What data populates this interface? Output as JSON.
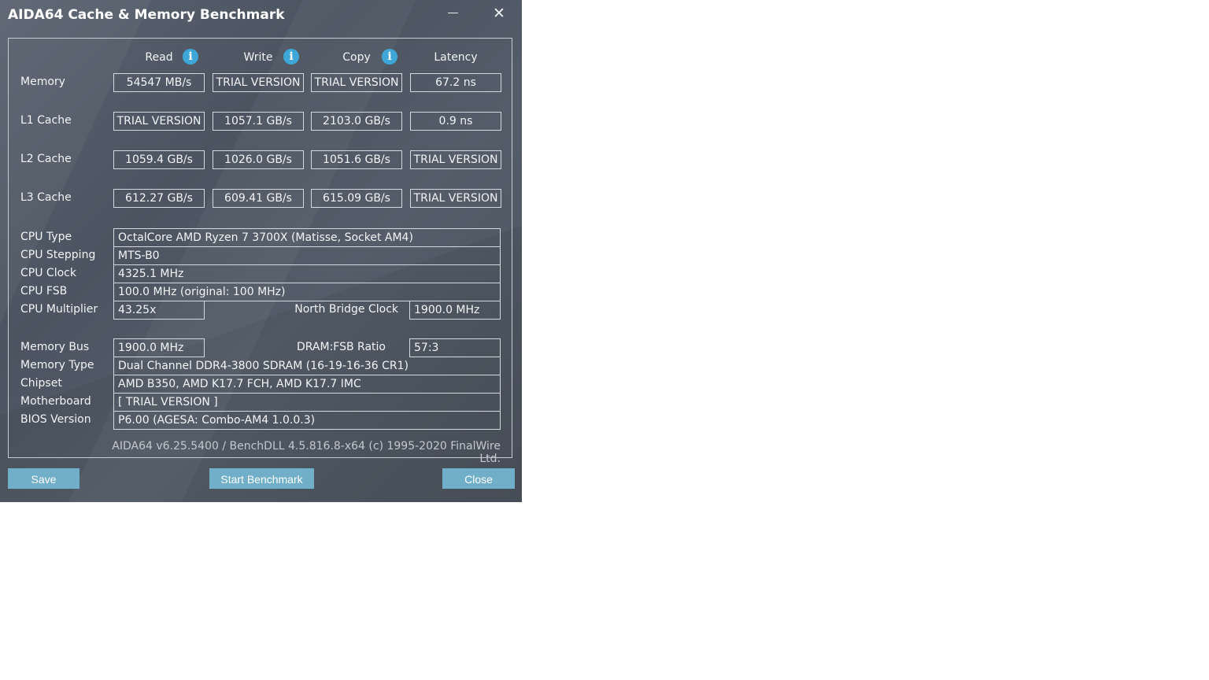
{
  "window": {
    "title": "AIDA64 Cache & Memory Benchmark",
    "close_glyph": "✕"
  },
  "columns": [
    "Read",
    "Write",
    "Copy",
    "Latency"
  ],
  "rows": [
    {
      "label": "Memory",
      "values": [
        "54547 MB/s",
        "TRIAL VERSION",
        "TRIAL VERSION",
        "67.2 ns"
      ]
    },
    {
      "label": "L1 Cache",
      "values": [
        "TRIAL VERSION",
        "1057.1 GB/s",
        "2103.0 GB/s",
        "0.9 ns"
      ]
    },
    {
      "label": "L2 Cache",
      "values": [
        "1059.4 GB/s",
        "1026.0 GB/s",
        "1051.6 GB/s",
        "TRIAL VERSION"
      ]
    },
    {
      "label": "L3 Cache",
      "values": [
        "612.27 GB/s",
        "609.41 GB/s",
        "615.09 GB/s",
        "TRIAL VERSION"
      ]
    }
  ],
  "info": {
    "cpu_type": {
      "label": "CPU Type",
      "value": "OctalCore AMD Ryzen 7 3700X  (Matisse, Socket AM4)"
    },
    "cpu_stepping": {
      "label": "CPU Stepping",
      "value": "MTS-B0"
    },
    "cpu_clock": {
      "label": "CPU Clock",
      "value": "4325.1 MHz"
    },
    "cpu_fsb": {
      "label": "CPU FSB",
      "value": "100.0 MHz  (original: 100 MHz)"
    },
    "cpu_mult": {
      "label": "CPU Multiplier",
      "value": "43.25x"
    },
    "nb_clock": {
      "label": "North Bridge Clock",
      "value": "1900.0 MHz"
    },
    "mem_bus": {
      "label": "Memory Bus",
      "value": "1900.0 MHz"
    },
    "dram_ratio": {
      "label": "DRAM:FSB Ratio",
      "value": "57:3"
    },
    "mem_type": {
      "label": "Memory Type",
      "value": "Dual Channel DDR4-3800 SDRAM  (16-19-16-36 CR1)"
    },
    "chipset": {
      "label": "Chipset",
      "value": "AMD B350, AMD K17.7 FCH, AMD K17.7 IMC"
    },
    "motherboard": {
      "label": "Motherboard",
      "value": "[ TRIAL VERSION ]"
    },
    "bios": {
      "label": "BIOS Version",
      "value": "P6.00  (AGESA: Combo-AM4 1.0.0.3)"
    }
  },
  "footer": "AIDA64 v6.25.5400 / BenchDLL 4.5.816.8-x64  (c) 1995-2020 FinalWire Ltd.",
  "buttons": {
    "save": "Save",
    "start": "Start Benchmark",
    "close": "Close"
  }
}
